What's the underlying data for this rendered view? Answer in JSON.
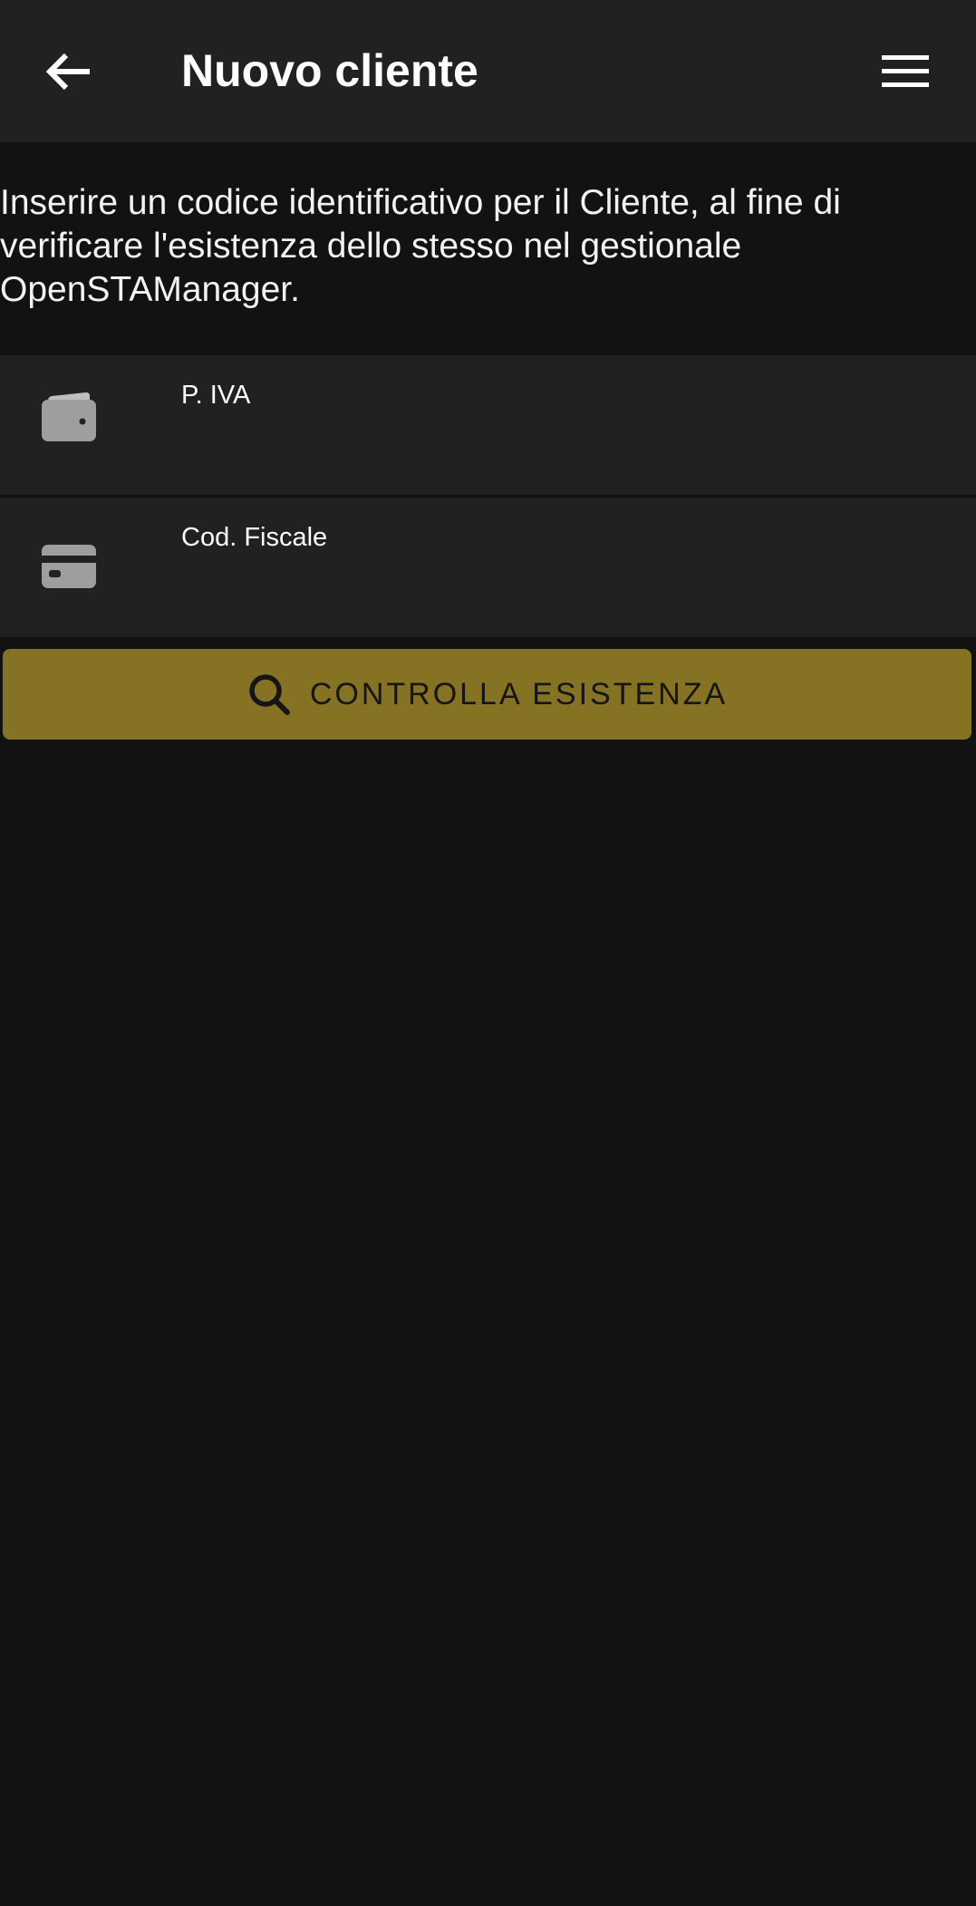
{
  "appbar": {
    "title": "Nuovo cliente",
    "back_icon": "arrow-left-icon",
    "menu_icon": "hamburger-menu-icon"
  },
  "intro": {
    "text": "Inserire un codice identificativo per il Cliente, al fine di verificare l'esistenza dello stesso nel gestionale OpenSTAManager."
  },
  "fields": {
    "piva": {
      "label": "P. IVA",
      "value": "",
      "icon": "wallet-icon"
    },
    "cf": {
      "label": "Cod. Fiscale",
      "value": "",
      "icon": "credit-card-icon"
    }
  },
  "check_button": {
    "label": "CONTROLLA ESISTENZA",
    "icon": "search-icon"
  },
  "colors": {
    "background": "#121212",
    "surface": "#212121",
    "accent": "#857222",
    "icon_gray": "#9e9e9e"
  }
}
